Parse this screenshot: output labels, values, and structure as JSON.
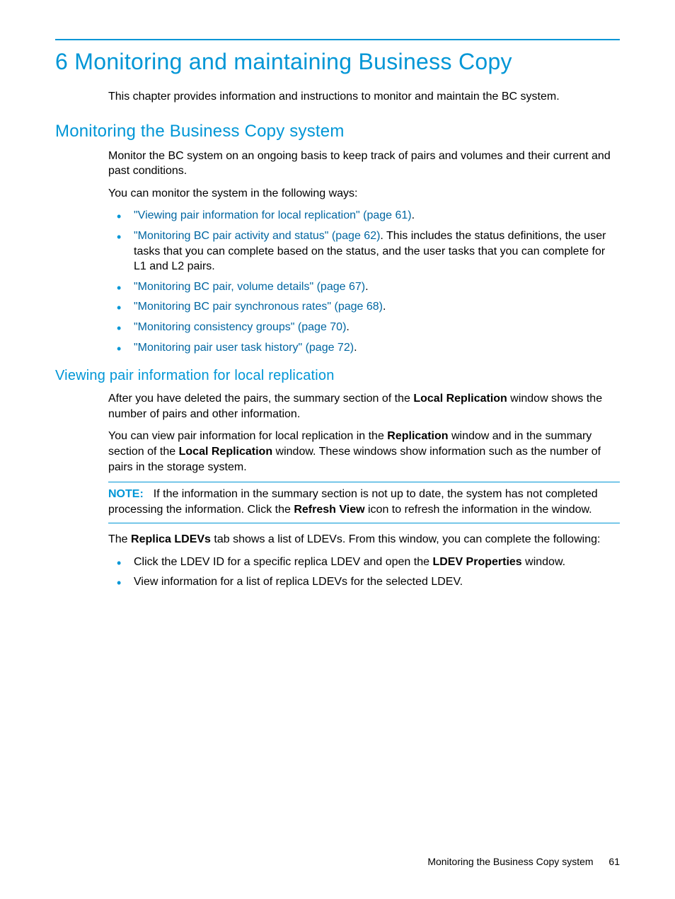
{
  "chapter": {
    "title": "6 Monitoring and maintaining Business Copy",
    "intro": "This chapter provides information and instructions to monitor and maintain the BC system."
  },
  "section1": {
    "title": "Monitoring the Business Copy system",
    "p1": "Monitor the BC system on an ongoing basis to keep track of pairs and volumes and their current and past conditions.",
    "p2": "You can monitor the system in the following ways:",
    "bullets": {
      "b1_link": "\"Viewing pair information for local replication\" (page 61)",
      "b1_tail": ".",
      "b2_link": "\"Monitoring BC pair activity and status\" (page 62)",
      "b2_tail": ". This includes the status definitions, the user tasks that you can complete based on the status, and the user tasks that you can complete for L1 and L2 pairs.",
      "b3_link": "\"Monitoring BC pair, volume details\" (page 67)",
      "b3_tail": ".",
      "b4_link": "\"Monitoring BC pair synchronous rates\" (page 68)",
      "b4_tail": ".",
      "b5_link": "\"Monitoring consistency groups\" (page 70)",
      "b5_tail": ".",
      "b6_link": "\"Monitoring pair user task history\" (page 72)",
      "b6_tail": "."
    }
  },
  "section2": {
    "title": "Viewing pair information for local replication",
    "p1_pre": "After you have deleted the pairs, the summary section of the ",
    "p1_b1": "Local Replication",
    "p1_post": " window shows the number of pairs and other information.",
    "p2_pre": "You can view pair information for local replication in the ",
    "p2_b1": "Replication",
    "p2_mid": " window and in the summary section of the ",
    "p2_b2": "Local Replication",
    "p2_post": " window. These windows show information such as the number of pairs in the storage system.",
    "note": {
      "label": "NOTE:",
      "pre": "If the information in the summary section is not up to date, the system has not completed processing the information. Click the ",
      "bold": "Refresh View",
      "post": " icon to refresh the information in the window."
    },
    "p3_pre": "The ",
    "p3_b1": "Replica LDEVs",
    "p3_post": " tab shows a list of LDEVs. From this window, you can complete the following:",
    "bullets2": {
      "b1_pre": "Click the LDEV ID for a specific replica LDEV and open the ",
      "b1_bold": "LDEV Properties",
      "b1_post": " window.",
      "b2": "View information for a list of replica LDEVs for the selected LDEV."
    }
  },
  "footer": {
    "text": "Monitoring the Business Copy system",
    "page": "61"
  }
}
